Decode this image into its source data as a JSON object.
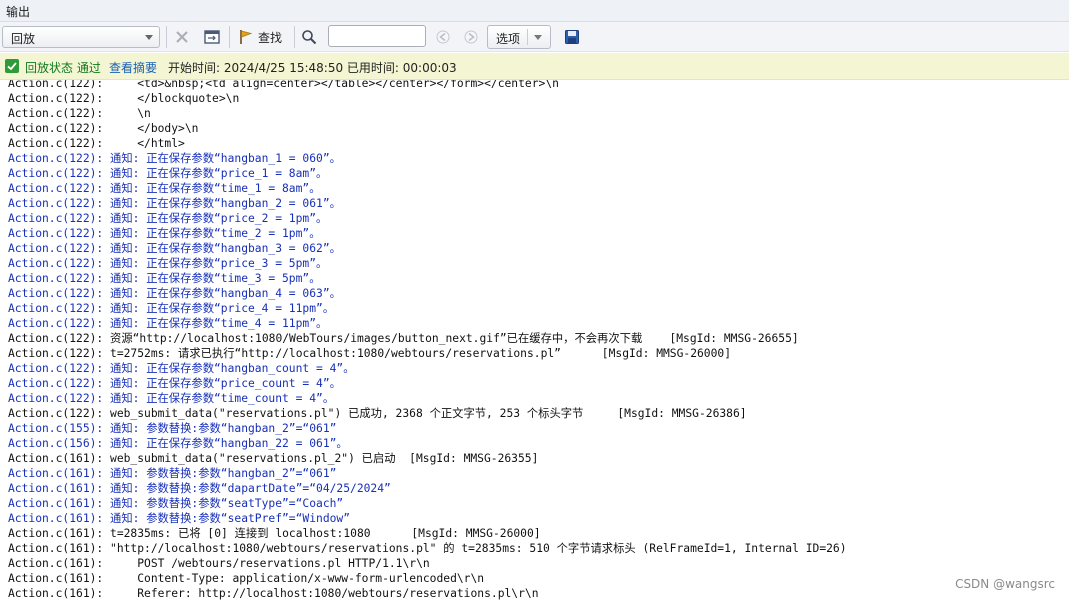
{
  "window": {
    "title": "输出"
  },
  "toolbar": {
    "mode_select": "回放",
    "find_label": "查找",
    "search_value": "",
    "options_label": "选项"
  },
  "status": {
    "pass_text": "回放状态 通过",
    "summary_link": "查看摘要",
    "time_info": "开始时间: 2024/4/25 15:48:50 已用时间: 00:00:03"
  },
  "log_lines": [
    {
      "kind": "normal",
      "text": "Action.c(122):     <td>&nbsp;<td align=center></table></center></form></center>\\n"
    },
    {
      "kind": "normal",
      "text": "Action.c(122):     </blockquote>\\n"
    },
    {
      "kind": "normal",
      "text": "Action.c(122):     \\n"
    },
    {
      "kind": "normal",
      "text": "Action.c(122):     </body>\\n"
    },
    {
      "kind": "normal",
      "text": "Action.c(122):     </html>"
    },
    {
      "kind": "notice",
      "text": "Action.c(122): 通知: 正在保存参数“hangban_1 = 060”。"
    },
    {
      "kind": "notice",
      "text": "Action.c(122): 通知: 正在保存参数“price_1 = 8am”。"
    },
    {
      "kind": "notice",
      "text": "Action.c(122): 通知: 正在保存参数“time_1 = 8am”。"
    },
    {
      "kind": "notice",
      "text": "Action.c(122): 通知: 正在保存参数“hangban_2 = 061”。"
    },
    {
      "kind": "notice",
      "text": "Action.c(122): 通知: 正在保存参数“price_2 = 1pm”。"
    },
    {
      "kind": "notice",
      "text": "Action.c(122): 通知: 正在保存参数“time_2 = 1pm”。"
    },
    {
      "kind": "notice",
      "text": "Action.c(122): 通知: 正在保存参数“hangban_3 = 062”。"
    },
    {
      "kind": "notice",
      "text": "Action.c(122): 通知: 正在保存参数“price_3 = 5pm”。"
    },
    {
      "kind": "notice",
      "text": "Action.c(122): 通知: 正在保存参数“time_3 = 5pm”。"
    },
    {
      "kind": "notice",
      "text": "Action.c(122): 通知: 正在保存参数“hangban_4 = 063”。"
    },
    {
      "kind": "notice",
      "text": "Action.c(122): 通知: 正在保存参数“price_4 = 11pm”。"
    },
    {
      "kind": "notice",
      "text": "Action.c(122): 通知: 正在保存参数“time_4 = 11pm”。"
    },
    {
      "kind": "normal",
      "text": "Action.c(122): 资源“http://localhost:1080/WebTours/images/button_next.gif”已在缓存中，不会再次下载    [MsgId: MMSG-26655]"
    },
    {
      "kind": "normal",
      "text": "Action.c(122): t=2752ms: 请求已执行“http://localhost:1080/webtours/reservations.pl”      [MsgId: MMSG-26000]"
    },
    {
      "kind": "notice",
      "text": "Action.c(122): 通知: 正在保存参数“hangban_count = 4”。"
    },
    {
      "kind": "notice",
      "text": "Action.c(122): 通知: 正在保存参数“price_count = 4”。"
    },
    {
      "kind": "notice",
      "text": "Action.c(122): 通知: 正在保存参数“time_count = 4”。"
    },
    {
      "kind": "normal",
      "text": "Action.c(122): web_submit_data(\"reservations.pl\") 已成功, 2368 个正文字节, 253 个标头字节     [MsgId: MMSG-26386]"
    },
    {
      "kind": "notice",
      "text": "Action.c(155): 通知: 参数替换:参数“hangban_2”=“061”"
    },
    {
      "kind": "notice",
      "text": "Action.c(156): 通知: 正在保存参数“hangban_22 = 061”。"
    },
    {
      "kind": "normal",
      "text": "Action.c(161): web_submit_data(\"reservations.pl_2\") 已启动  [MsgId: MMSG-26355]"
    },
    {
      "kind": "notice",
      "text": "Action.c(161): 通知: 参数替换:参数“hangban_2”=“061”"
    },
    {
      "kind": "notice",
      "text": "Action.c(161): 通知: 参数替换:参数“dapartDate”=“04/25/2024”"
    },
    {
      "kind": "notice",
      "text": "Action.c(161): 通知: 参数替换:参数“seatType”=“Coach”"
    },
    {
      "kind": "notice",
      "text": "Action.c(161): 通知: 参数替换:参数“seatPref”=“Window”"
    },
    {
      "kind": "normal",
      "text": "Action.c(161): t=2835ms: 已将 [0] 连接到 localhost:1080      [MsgId: MMSG-26000]"
    },
    {
      "kind": "normal",
      "text": "Action.c(161): \"http://localhost:1080/webtours/reservations.pl\" 的 t=2835ms: 510 个字节请求标头 (RelFrameId=1, Internal ID=26)"
    },
    {
      "kind": "normal",
      "text": "Action.c(161):     POST /webtours/reservations.pl HTTP/1.1\\r\\n"
    },
    {
      "kind": "normal",
      "text": "Action.c(161):     Content-Type: application/x-www-form-urlencoded\\r\\n"
    },
    {
      "kind": "normal",
      "text": "Action.c(161):     Referer: http://localhost:1080/webtours/reservations.pl\\r\\n"
    }
  ],
  "watermark": "CSDN @wangsrc"
}
